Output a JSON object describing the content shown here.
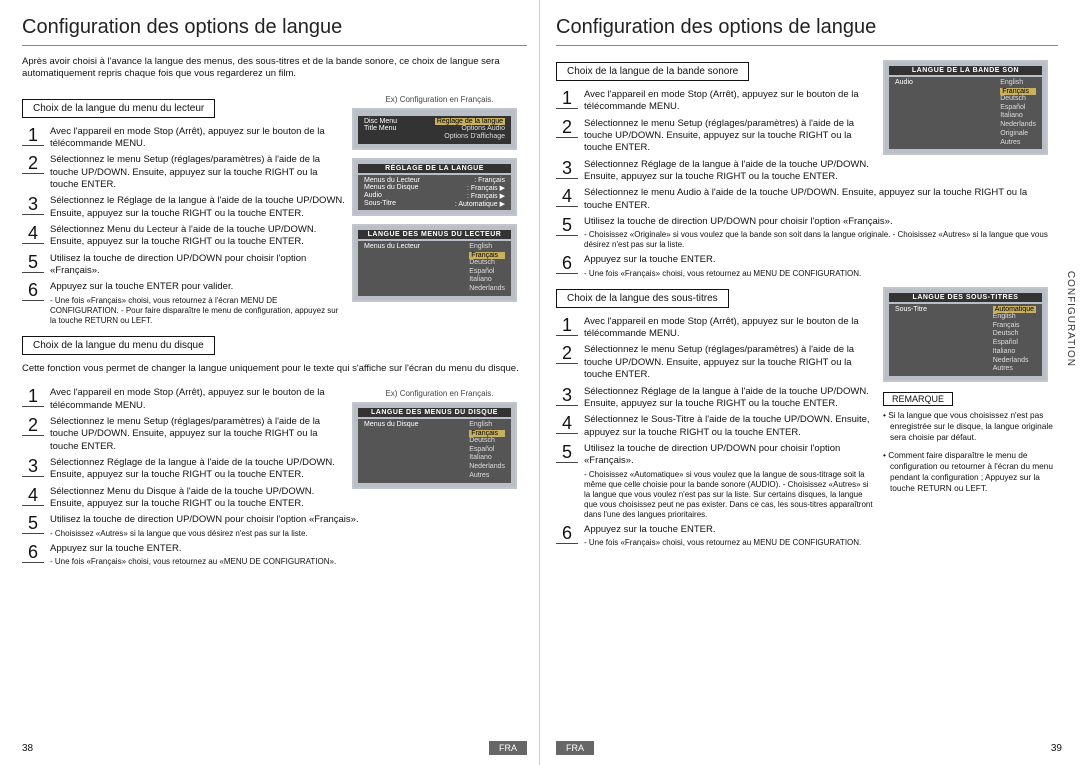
{
  "left": {
    "title": "Configuration des options de langue",
    "intro": "Après avoir choisi à l'avance la langue des menus, des sous-titres et de la bande sonore, ce choix de langue sera automatiquement repris chaque fois que vous regarderez un film.",
    "sectionA": {
      "heading": "Choix de la langue du menu du lecteur",
      "osd_caption": "Ex) Configuration en Français.",
      "steps": [
        {
          "n": "1",
          "t": "Avec l'appareil en mode Stop (Arrêt), appuyez sur le bouton de la télécommande MENU."
        },
        {
          "n": "2",
          "t": "Sélectionnez le menu Setup (réglages/paramètres) à l'aide de la touche UP/DOWN. Ensuite, appuyez sur la touche RIGHT ou la touche ENTER."
        },
        {
          "n": "3",
          "t": "Sélectionnez le Réglage de la langue à l'aide de la touche UP/DOWN. Ensuite, appuyez sur la touche RIGHT ou la touche ENTER."
        },
        {
          "n": "4",
          "t": "Sélectionnez Menu du Lecteur à l'aide de la touche UP/DOWN. Ensuite, appuyez sur la touche RIGHT ou la touche ENTER."
        },
        {
          "n": "5",
          "t": "Utilisez la touche de direction UP/DOWN pour choisir l'option «Français»."
        },
        {
          "n": "6",
          "t": "Appuyez sur la touche ENTER pour valider.",
          "note": "- Une fois «Français» choisi, vous retournez à l'écran MENU DE CONFIGURATION.\n- Pour faire disparaître le menu de configuration, appuyez sur la touche RETURN ou LEFT."
        }
      ],
      "osd1": {
        "title": "Réglage de la langue",
        "rows": [
          "Options Audio",
          "Options D'affichage"
        ],
        "ctx": [
          "Disc Menu",
          "Title Menu"
        ]
      },
      "osd2": {
        "title": "RÉGLAGE DE LA LANGUE",
        "rows": [
          [
            "Menus du Lecteur",
            ": Français"
          ],
          [
            "Menus du Disque",
            ": Français  ▶"
          ],
          [
            "Audio",
            ": Français  ▶"
          ],
          [
            "Sous-Titre",
            ": Automatique ▶"
          ]
        ]
      },
      "osd3": {
        "title": "LANGUE DES MENUS DU LECTEUR",
        "left": "Menus du Lecteur",
        "sel": "Français",
        "opts": [
          "English",
          "Deutsch",
          "Español",
          "Italiano",
          "Nederlands"
        ]
      }
    },
    "sectionB": {
      "heading": "Choix de la langue du menu du disque",
      "intro": "Cette fonction vous permet de changer la langue uniquement pour le texte qui s'affiche sur l'écran du menu du disque.",
      "osd_caption": "Ex) Configuration en Français.",
      "steps": [
        {
          "n": "1",
          "t": "Avec l'appareil en mode Stop (Arrêt), appuyez sur le bouton de la télécommande MENU."
        },
        {
          "n": "2",
          "t": "Sélectionnez le menu Setup (réglages/paramètres) à l'aide de la touche UP/DOWN. Ensuite, appuyez sur la touche RIGHT ou la touche ENTER."
        },
        {
          "n": "3",
          "t": "Sélectionnez Réglage de la langue à l'aide de la touche UP/DOWN. Ensuite, appuyez sur la touche RIGHT ou la touche ENTER."
        },
        {
          "n": "4",
          "t": "Sélectionnez Menu du Disque à l'aide de la touche UP/DOWN. Ensuite, appuyez sur la touche RIGHT ou la touche ENTER."
        },
        {
          "n": "5",
          "t": "Utilisez la touche de direction UP/DOWN pour choisir l'option «Français».",
          "note": "- Choisissez «Autres» si la langue que vous désirez n'est pas sur la liste."
        },
        {
          "n": "6",
          "t": "Appuyez sur la touche ENTER.",
          "note": "- Une fois «Français» choisi, vous retournez au «MENU DE CONFIGURATION»."
        }
      ],
      "osd": {
        "title": "LANGUE DES MENUS DU DISQUE",
        "left": "Menus du Disque",
        "sel": "Français",
        "opts": [
          "English",
          "Deutsch",
          "Español",
          "Italiano",
          "Nederlands",
          "Autres"
        ]
      }
    },
    "pagenum": "38",
    "fra": "FRA"
  },
  "right": {
    "title": "Configuration des options de langue",
    "sectionA": {
      "heading": "Choix de la langue de la bande sonore",
      "steps": [
        {
          "n": "1",
          "t": "Avec l'appareil en mode Stop (Arrêt), appuyez sur le bouton de la télécommande MENU."
        },
        {
          "n": "2",
          "t": "Sélectionnez le menu Setup (réglages/paramètres) à l'aide de la touche UP/DOWN. Ensuite, appuyez sur la touche RIGHT ou la touche ENTER."
        },
        {
          "n": "3",
          "t": "Sélectionnez Réglage de la langue à l'aide de la touche UP/DOWN. Ensuite, appuyez sur la touche RIGHT ou la touche ENTER."
        },
        {
          "n": "4",
          "t": "Sélectionnez le menu Audio à l'aide de la touche UP/DOWN. Ensuite, appuyez sur la touche RIGHT ou la touche ENTER."
        },
        {
          "n": "5",
          "t": "Utilisez la touche de direction UP/DOWN pour choisir l'option «Français».",
          "note": "- Choisissez «Originale» si vous voulez que la bande son soit dans la langue originale.\n- Choisissez «Autres» si la langue que vous désirez n'est pas sur la liste."
        },
        {
          "n": "6",
          "t": "Appuyez sur la touche ENTER.",
          "note": "- Une fois «Français» choisi, vous retournez au MENU DE CONFIGURATION."
        }
      ],
      "osd": {
        "title": "LANGUE DE LA BANDE SON",
        "left": "Audio",
        "sel": "Français",
        "opts": [
          "English",
          "Deutsch",
          "Español",
          "Italiano",
          "Nederlands",
          "Originale",
          "Autres"
        ]
      }
    },
    "sectionB": {
      "heading": "Choix de la langue des sous-titres",
      "steps": [
        {
          "n": "1",
          "t": "Avec l'appareil en mode Stop (Arrêt), appuyez sur le bouton de la télécommande MENU."
        },
        {
          "n": "2",
          "t": "Sélectionnez le menu Setup (réglages/paramètres) à l'aide de la touche UP/DOWN. Ensuite, appuyez sur la touche RIGHT ou la touche ENTER."
        },
        {
          "n": "3",
          "t": "Sélectionnez Réglage de la langue à l'aide de la touche UP/DOWN. Ensuite, appuyez sur la touche RIGHT ou la touche ENTER."
        },
        {
          "n": "4",
          "t": "Sélectionnez le Sous-Titre à l'aide de la touche UP/DOWN. Ensuite, appuyez sur la touche RIGHT ou la touche ENTER."
        },
        {
          "n": "5",
          "t": "Utilisez la touche de direction UP/DOWN pour choisir l'option «Français».",
          "note": "- Choisissez «Automatique» si vous voulez que la langue de sous-titrage soit la même que celle choisie pour la bande sonore (AUDIO).\n- Choisissez «Autres» si la langue que vous voulez n'est pas sur la liste. Sur certains disques, la langue que vous choisissez peut ne pas exister. Dans ce cas, les sous-titres apparaîtront dans l'une des langues prioritaires."
        },
        {
          "n": "6",
          "t": "Appuyez sur la touche ENTER.",
          "note": "- Une fois «Français» choisi, vous retournez au MENU DE CONFIGURATION."
        }
      ],
      "osd": {
        "title": "LANGUE DES SOUS-TITRES",
        "left": "Sous-Titre",
        "sel": "Automatique",
        "opts": [
          "English",
          "Français",
          "Deutsch",
          "Español",
          "Italiano",
          "Nederlands",
          "Autres"
        ]
      }
    },
    "remarque": {
      "head": "REMARQUE",
      "items": [
        "Si la langue que vous choisissez n'est pas enregistrée sur le disque, la langue originale sera choisie par défaut.",
        "Comment faire disparaître le menu de configuration ou retourner à l'écran du menu pendant la configuration ; Appuyez sur la touche RETURN ou LEFT."
      ]
    },
    "sidetab": "CONFIGURATION",
    "pagenum": "39",
    "fra": "FRA"
  }
}
